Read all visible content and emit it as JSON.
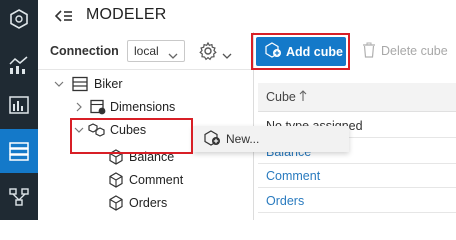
{
  "header": {
    "title": "MODELER"
  },
  "left_panel": {
    "connection_label": "Connection",
    "connection_value": "local",
    "tree": {
      "root": "Biker",
      "dimensions": "Dimensions",
      "cubes": "Cubes",
      "cube_items": [
        "Balance",
        "Comment",
        "Orders"
      ]
    }
  },
  "context_menu": {
    "new_label": "New..."
  },
  "toolbar": {
    "add_cube_label": "Add cube",
    "delete_cube_label": "Delete cube"
  },
  "table": {
    "column_header": "Cube",
    "rows": [
      "No type assigned",
      "Balance",
      "Comment",
      "Orders"
    ]
  },
  "colors": {
    "accent": "#1479c9",
    "highlight": "#d81f26",
    "rail": "#1f2a33"
  }
}
